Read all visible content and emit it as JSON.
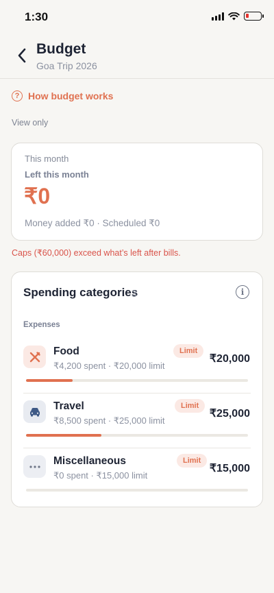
{
  "status": {
    "time": "1:30"
  },
  "header": {
    "title": "Budget",
    "subtitle": "Goa Trip 2026"
  },
  "how_link": {
    "label": "How budget works"
  },
  "view_only": "View only",
  "month_card": {
    "label": "This month",
    "left_label": "Left this month",
    "amount": "₹0",
    "meta": "Money added ₹0 · Scheduled ₹0"
  },
  "warning": "Caps (₹60,000) exceed what’s left after bills.",
  "categories": {
    "title": "Spending categories",
    "count": "3",
    "section_label": "Expenses",
    "items": [
      {
        "name": "Food",
        "meta": "₹4,200 spent · ₹20,000 limit",
        "badge": "Limit",
        "amount": "₹20,000",
        "progress": 0.21,
        "icon": "utensils-icon"
      },
      {
        "name": "Travel",
        "meta": "₹8,500 spent · ₹25,000 limit",
        "badge": "Limit",
        "amount": "₹25,000",
        "progress": 0.34,
        "icon": "car-icon"
      },
      {
        "name": "Miscellaneous",
        "meta": "₹0 spent · ₹15,000 limit",
        "badge": "Limit",
        "amount": "₹15,000",
        "progress": 0,
        "icon": "more-dots-icon"
      }
    ]
  },
  "colors": {
    "accent": "#e07150",
    "warning": "#d9534a",
    "travel_icon_bg": "#e8ebf1",
    "food_icon_bg": "#fbe9e4"
  }
}
